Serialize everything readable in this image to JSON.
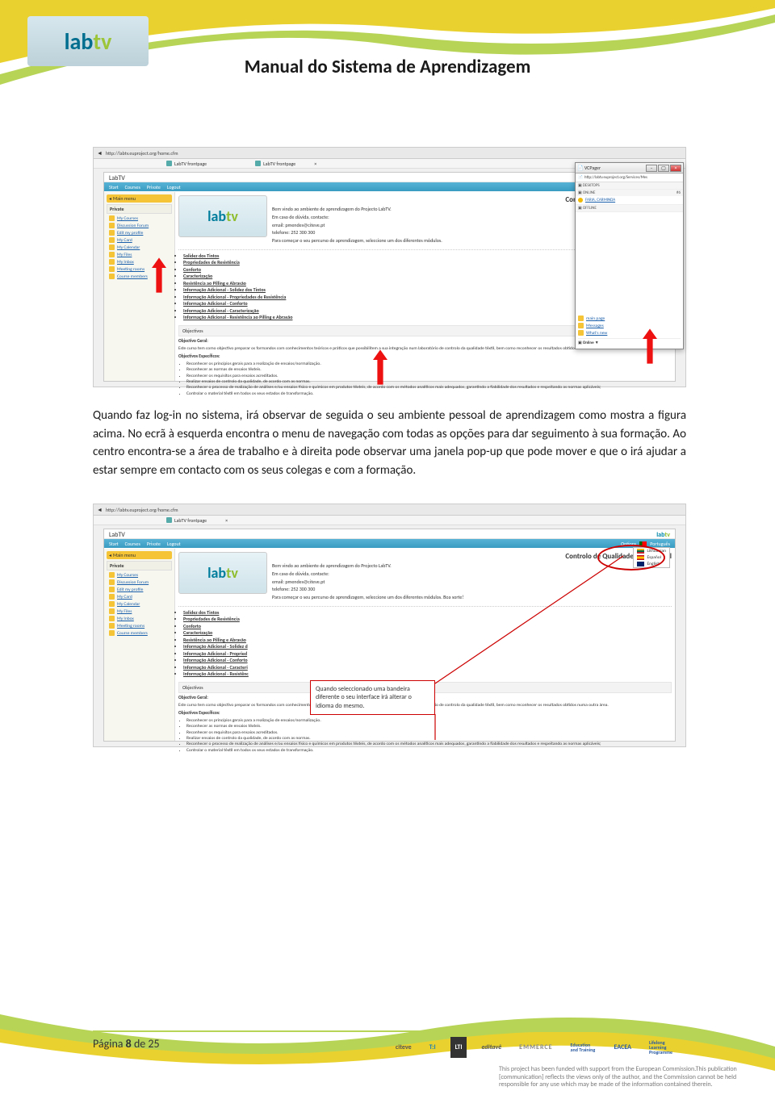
{
  "doc_title": "Manual do Sistema de Aprendizagem",
  "logo_text_main": "lab",
  "logo_text_accent": "tv",
  "browser": {
    "url": "http://labtv.euproject.org/home.cfm",
    "tab1": "LabTV frontpage",
    "tab2": "LabTV frontpage"
  },
  "app": {
    "title": "LabTV",
    "nav": [
      "Start",
      "Courses",
      "Private",
      "Logout"
    ],
    "nav_options": "Options",
    "lang": {
      "pt": "Português",
      "lt": "Lithuanian",
      "es": "Español",
      "en": "English"
    },
    "sidebar": {
      "main_menu": "Main menu",
      "private": "Private",
      "items": [
        "My Courses",
        "Discussion Forum",
        "Edit my profile",
        "My Card",
        "My Calendar",
        "My Files",
        "My Inbox",
        "Meeting rooms",
        "Course members"
      ]
    },
    "content": {
      "heading": "Controlo de Qualidade Laboratorial",
      "welcome": "Bem vindo ao ambiente de aprendizagem do Projecto LabTV.",
      "contact_label": "Em caso de dúvida, contacte:",
      "email": "email: pmendes@citeve.pt",
      "phone": "telefone: 252 300 300",
      "start_hint": "Para começar o seu percurso de aprendizagem, seleccione um dos diferentes módulos.",
      "start_hint_extra": "Boa sorte!",
      "modules": [
        "Solidez dos Tintos",
        "Propriedades de Resistência",
        "Conforto",
        "Caracterização",
        "Resistência ao Pilling e Abrasão",
        "Informação Adicional - Solidez dos Tintos",
        "Informação Adicional - Propriedades de Resistência",
        "Informação Adicional - Conforto",
        "Informação Adicional - Caracterização",
        "Informação Adicional - Resistência ao Pilling e Abrasão"
      ],
      "modules_short": [
        "Solidez dos Tintos",
        "Propriedades de Resistência",
        "Conforto",
        "Caracterização",
        "Resistência ao Pilling e Abrasão",
        "Informação Adicional - Solidez d",
        "Informação Adicional - Propried",
        "Informação Adicional - Conforto",
        "Informação Adicional - Caracteri",
        "Informação Adicional - Resistênc"
      ],
      "objectives_section": "Objectivos",
      "general_label": "Objectivo Geral:",
      "general_text": "Este curso tem como objectivo preparar os formandos com conhecimentos teóricos e práticos que possibilitem a sua integração num laboratório de controlo da qualidade têxtil, bem como reconhecer os resultados obtidos numa outra área.",
      "specific_label": "Objectivos Específicos:",
      "specific_items": [
        "Reconhecer os princípios gerais para a realização de ensaios/normalização.",
        "Reconhecer as normas de ensaios têxteis.",
        "Reconhecer os requisitos para ensaios acreditados.",
        "Realizar ensaios de controlo da qualidade, de acordo com as normas.",
        "Reconhecer o processo de realização de análises e/ou ensaios físico e químicos em produtos têxteis, de acordo com os métodos analíticos mais adequados, garantindo a fiabilidade dos resultados e respeitando as normas aplicáveis;",
        "Controlar o material têxtil em todos os seus estados de transformação."
      ]
    }
  },
  "popup": {
    "title": "VCPager",
    "url": "http://labtv.euproject.org/Services/Mes",
    "desktops": "DESKTOPS",
    "online_h": "ONLINE",
    "online_count": "#6",
    "user1": "FARIA, CARMINDA",
    "offline_h": "OFFLINE",
    "links": {
      "main_page": "main page",
      "messages": "Messages",
      "whats_new": "What's new"
    },
    "online_dropdown": "Online"
  },
  "body_para": "Quando faz log-in no sistema, irá observar de seguida o seu ambiente pessoal de aprendizagem como mostra a figura acima. No ecrã à esquerda encontra o menu de navegação com todas as opções para dar seguimento à sua formação. Ao centro encontra-se a área de trabalho e à direita pode observar uma janela pop-up que pode mover e que o irá ajudar a estar sempre em contacto com os seus colegas e com a formação.",
  "callout_text": "Quando seleccionado uma bandeira diferente o seu interface irá alterar o idioma do mesmo.",
  "footer": {
    "page": "Página 8 de 25",
    "logos": [
      "citeve",
      "T:I",
      "LTI",
      "editavê",
      "EMMERCE",
      "Education and Training",
      "EACEA",
      "Lifelong Learning Programme"
    ]
  },
  "disclaimer": "This project has been funded with support from the European Commission.This publication [communication] reflects the views only of the author, and the Commission cannot be held responsible for any use which may be made of the information contained therein."
}
